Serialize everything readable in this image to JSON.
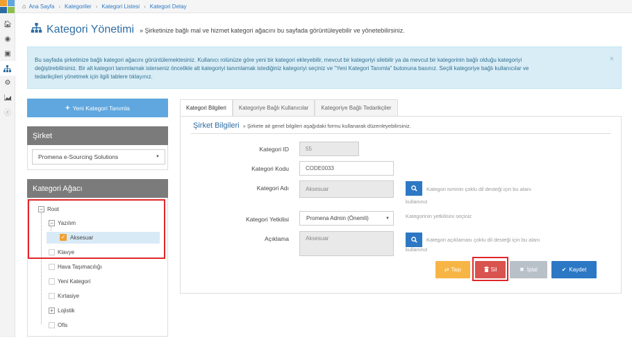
{
  "rail": {
    "colors": [
      "#f0a030",
      "#5fa7de",
      "#2d6ca2",
      "#8cc04b"
    ],
    "icons": [
      "home-icon",
      "globe-icon",
      "briefcase-icon",
      "sitemap-icon",
      "gear-icon",
      "chart-icon",
      "chevron-circle-icon"
    ]
  },
  "breadcrumb": [
    "Ana Sayfa",
    "Kategoriler",
    "Kategori Listesi",
    "Kategori Detay"
  ],
  "header": {
    "title": "Kategori Yönetimi",
    "subtitle": "» Şirketinize bağlı mal ve hizmet kategori ağacını bu sayfada görüntüleyebilir ve yönetebilirsiniz."
  },
  "alert": {
    "line1": "Bu sayfada şirketinize bağlı kategori ağacını görüntülemektesiniz. Kullanıcı rolünüze göre yeni bir kategori ekleyebilir, mevcut bir kategoriyi silebilir ya da mevcut bir kategorinin bağlı olduğu kategoriyi",
    "line2": "değiştirebilirsiniz. Bir alt kategori tanımlamak isterseniz öncelikle alt kategoriyi tanımlamak istediğiniz kategoriyi seçiniz ve \"Yeni Kategori Tanımla\" butonuna basınız. Seçili kategoriye bağlı kullanıcılar ve",
    "line3": "tedarikçileri yönetmek için ilgili tablere tıklayınız.",
    "close": "×"
  },
  "left": {
    "new_button": "Yeni Kategori Tanımla",
    "company_title": "Şirket",
    "company_value": "Promena e-Sourcing Solutions",
    "tree_title": "Kategori Ağacı",
    "tree": {
      "root": "Root",
      "yazilim": "Yazılım",
      "aksesuar": "Aksesuar",
      "klavye": "Klavye",
      "hava": "Hava Taşımacılığı",
      "yeni": "Yeni Kategori",
      "kirtasiye": "Kırtasiye",
      "lojistik": "Lojistik",
      "ofis": "Ofis"
    }
  },
  "tabs": [
    "Kategori Bilgileri",
    "Kategoriye Bağlı Kullanıcılar",
    "Kategoriye Bağlı Tedarikçiler"
  ],
  "form": {
    "section_title": "Şirket Bilgileri",
    "section_desc": "» Şirkete ait genel bilgileri aşağıdaki formu kullanarak düzenleyebilirsiniz.",
    "id_label": "Kategori ID",
    "id_value": "55",
    "code_label": "Kategori Kodu",
    "code_value": "CODE0033",
    "name_label": "Kategori Adı",
    "name_value": "Aksesuar",
    "name_help_1": "Kategori isminin çoklu dil desteği için bu alanı",
    "name_help_2": "kullanınız",
    "auth_label": "Kategori Yetkilisi",
    "auth_value": "Promena Admin (Önemli)",
    "auth_help": "Kategorinin yetkilisini seçiniz",
    "desc_label": "Açıklama",
    "desc_value": "Aksesuar",
    "desc_help_1": "Kategori açıklaması çoklu dil desteği için bu alanı",
    "desc_help_2": "kullanınız"
  },
  "actions": {
    "move": "Taşı",
    "delete": "Sil",
    "cancel": "İptal",
    "save": "Kaydet",
    "colors": {
      "move": "#f6b545",
      "delete": "#d9534f",
      "cancel": "#b8c0c8",
      "save": "#2d78c5"
    }
  }
}
